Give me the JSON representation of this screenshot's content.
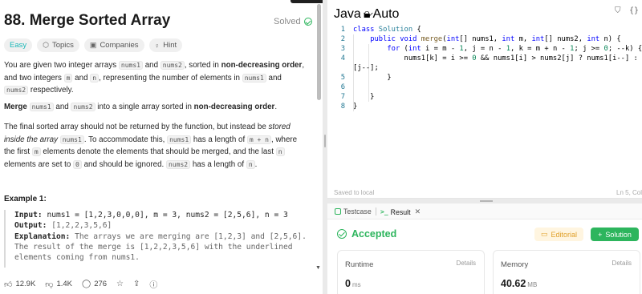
{
  "problem": {
    "title": "88. Merge Sorted Array",
    "status": "Solved",
    "tags": {
      "difficulty": "Easy",
      "topics": "Topics",
      "companies": "Companies",
      "hint": "Hint"
    },
    "p1": {
      "a": "You are given two integer arrays ",
      "c1": "nums1",
      "b": " and ",
      "c2": "nums2",
      "c": ", sorted in ",
      "bold": "non-decreasing order",
      "d": ", and two integers ",
      "c3": "m",
      "e": " and ",
      "c4": "n",
      "f": ", representing the number of elements in ",
      "c5": "nums1",
      "g": " and ",
      "c6": "nums2",
      "h": " respectively."
    },
    "p2": {
      "bold1": "Merge",
      "c1": "nums1",
      "a": " and ",
      "c2": "nums2",
      "b": " into a single array sorted in ",
      "bold2": "non-decreasing order",
      "c": "."
    },
    "p3": {
      "a": "The final sorted array should not be returned by the function, but instead be ",
      "italic": "stored inside the array",
      "sp": " ",
      "c1": "nums1",
      "b": ". To accommodate this, ",
      "c2": "nums1",
      "c": " has a length of ",
      "c3": "m + n",
      "d": ", where the first ",
      "c4": "m",
      "e": " elements denote the elements that should be merged, and the last ",
      "c5": "n",
      "f": " elements are set to ",
      "c6": "0",
      "g": " and should be ignored. ",
      "c7": "nums2",
      "h": " has a length of ",
      "c8": "n",
      "i": "."
    },
    "example_title": "Example 1:",
    "example": {
      "input_label": "Input:",
      "input": "nums1 = [1,2,3,0,0,0], m = 3, nums2 = [2,5,6], n = 3",
      "output_label": "Output:",
      "output": "[1,2,2,3,5,6]",
      "expl_label": "Explanation:",
      "expl1": "The arrays we are merging are [1,2,3] and [2,5,6].",
      "expl2": "The result of the merge is [1,2,2,3,5,6] with the underlined",
      "expl3": "elements coming from nums1."
    },
    "footer": {
      "likes": "12.9K",
      "dislikes": "1.4K",
      "comments": "276"
    }
  },
  "editor": {
    "language": "Java",
    "mode": "Auto",
    "line_numbers": [
      "1",
      "2",
      "3",
      "4",
      "",
      "5",
      "6",
      "7",
      "8"
    ],
    "saved": "Saved to local",
    "cursor": "Ln 5, Col"
  },
  "result": {
    "tab_testcase": "Testcase",
    "tab_result": "Result",
    "status": "Accepted",
    "editorial": "Editorial",
    "solution": "Solution",
    "runtime_label": "Runtime",
    "runtime_value": "0",
    "runtime_unit": "ms",
    "memory_label": "Memory",
    "memory_value": "40.62",
    "memory_unit": "MB",
    "details": "Details"
  },
  "colors": {
    "accent_green": "#2db55d",
    "easy": "#1cb8b8",
    "editorial": "#e0a02a"
  }
}
